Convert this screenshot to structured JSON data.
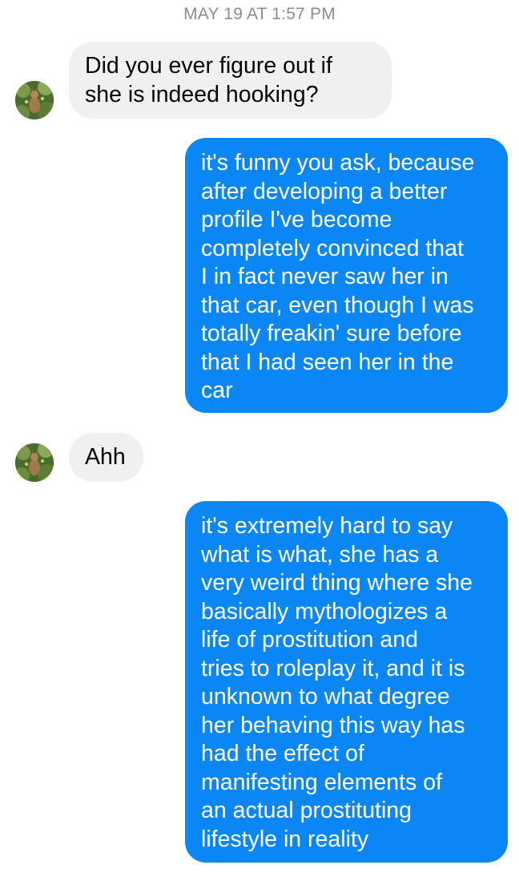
{
  "conversation": {
    "timestamp": "MAY 19 AT 1:57 PM",
    "messages": [
      {
        "sender": "other",
        "lines": [
          "Did you ever figure out if",
          "she is indeed hooking?"
        ]
      },
      {
        "sender": "me",
        "lines": [
          "it's funny you ask, because",
          "after developing a better",
          "profile I've become",
          "completely convinced that",
          "I in fact never saw her in",
          "that car, even though I was",
          "totally freakin' sure before",
          "that I had seen her in the",
          "car"
        ]
      },
      {
        "sender": "other",
        "lines": [
          "Ahh"
        ]
      },
      {
        "sender": "me",
        "lines": [
          "it's extremely hard to say",
          "what is what, she has a",
          "very weird thing where she",
          "basically mythologizes a",
          "life of prostitution and",
          "tries to roleplay it, and it is",
          "unknown to what degree",
          "her behaving this way has",
          "had the effect of",
          "manifesting elements of",
          "an actual prostituting",
          "lifestyle in reality"
        ]
      }
    ]
  },
  "colors": {
    "outgoing_bubble": "#0b86f5",
    "incoming_bubble": "#f1f0f0",
    "timestamp_text": "#8a8d91"
  },
  "icons": {
    "avatar": "contact-photo-avatar"
  }
}
